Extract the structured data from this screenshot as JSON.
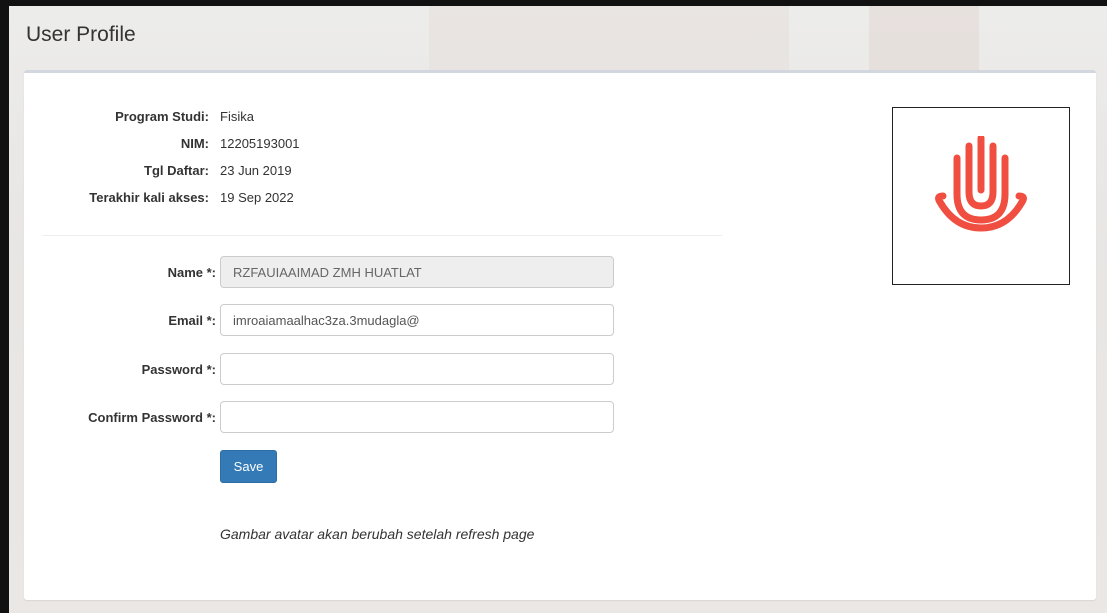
{
  "page": {
    "title": "User Profile"
  },
  "profile_info": [
    {
      "label": "Program Studi:",
      "value": "Fisika"
    },
    {
      "label": "NIM:",
      "value": "12205193001"
    },
    {
      "label": "Tgl Daftar:",
      "value": "23 Jun 2019"
    },
    {
      "label": "Terakhir kali akses:",
      "value": "19 Sep 2022"
    }
  ],
  "form": {
    "name": {
      "label": "Name *:",
      "value": "RZFAUIAAIMAD ZMH HUATLAT"
    },
    "email": {
      "label": "Email *:",
      "value": "imroaiamaalhac3za.3mudagla@"
    },
    "password": {
      "label": "Password *:",
      "value": ""
    },
    "confirm_password": {
      "label": "Confirm Password *:",
      "value": ""
    },
    "save_label": "Save",
    "note": "Gambar avatar akan berubah setelah refresh page"
  },
  "avatar": {
    "icon": "hand-icon",
    "color": "#f04e40"
  }
}
